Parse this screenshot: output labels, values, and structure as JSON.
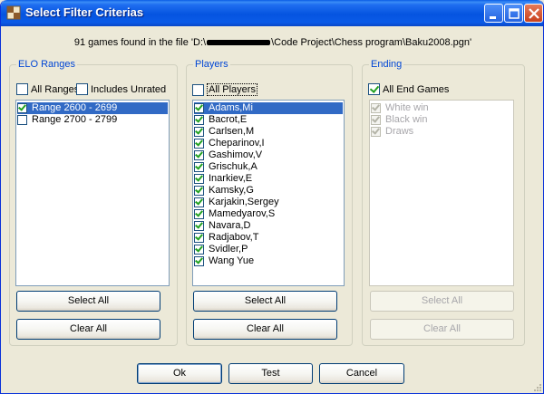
{
  "window": {
    "title": "Select Filter Criterias"
  },
  "info": {
    "prefix": "91 games found in the file 'D:\\",
    "suffix": "\\Code Project\\Chess program\\Baku2008.pgn'"
  },
  "elo": {
    "label": "ELO Ranges",
    "all_ranges_label": "All Ranges",
    "all_ranges_checked": false,
    "includes_unrated_label": "Includes Unrated",
    "includes_unrated_checked": false,
    "items": [
      {
        "label": "Range 2600 - 2699",
        "checked": true,
        "selected": true
      },
      {
        "label": "Range 2700 - 2799",
        "checked": false,
        "selected": false
      }
    ],
    "select_all": "Select All",
    "clear_all": "Clear All"
  },
  "players": {
    "label": "Players",
    "all_label": "All Players",
    "all_checked": false,
    "items": [
      {
        "label": "Adams,Mi",
        "checked": true,
        "selected": true
      },
      {
        "label": "Bacrot,E",
        "checked": true
      },
      {
        "label": "Carlsen,M",
        "checked": true
      },
      {
        "label": "Cheparinov,I",
        "checked": true
      },
      {
        "label": "Gashimov,V",
        "checked": true
      },
      {
        "label": "Grischuk,A",
        "checked": true
      },
      {
        "label": "Inarkiev,E",
        "checked": true
      },
      {
        "label": "Kamsky,G",
        "checked": true
      },
      {
        "label": "Karjakin,Sergey",
        "checked": true
      },
      {
        "label": "Mamedyarov,S",
        "checked": true
      },
      {
        "label": "Navara,D",
        "checked": true
      },
      {
        "label": "Radjabov,T",
        "checked": true
      },
      {
        "label": "Svidler,P",
        "checked": true
      },
      {
        "label": "Wang Yue",
        "checked": true
      }
    ],
    "select_all": "Select All",
    "clear_all": "Clear All"
  },
  "ending": {
    "label": "Ending",
    "all_label": "All End Games",
    "all_checked": true,
    "items": [
      {
        "label": "White win",
        "checked": true
      },
      {
        "label": "Black win",
        "checked": true
      },
      {
        "label": "Draws",
        "checked": true
      }
    ],
    "select_all": "Select All",
    "clear_all": "Clear All"
  },
  "footer": {
    "ok": "Ok",
    "test": "Test",
    "cancel": "Cancel"
  },
  "colors": {
    "titlebar": "#0554e0",
    "selection": "#316ac5",
    "group_label": "#0046d5",
    "check": "#21a121"
  },
  "icons": {
    "app": "chess-app-icon",
    "minimize": "minimize-icon",
    "maximize": "maximize-icon",
    "close": "close-icon"
  }
}
